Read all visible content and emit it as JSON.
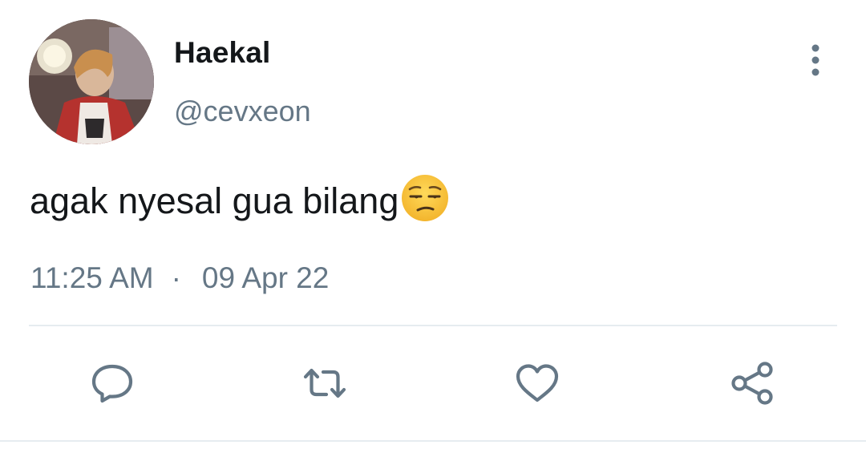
{
  "tweet": {
    "author": {
      "display_name": "Haekal",
      "handle": "@cevxeon"
    },
    "text": "agak nyesal gua bilang",
    "emoji": "unamused-face-emoji",
    "time": "11:25 AM",
    "separator": "·",
    "date": "09 Apr 22"
  },
  "actions": {
    "reply_icon": "speech-bubble-icon",
    "retweet_icon": "retweet-arrows-icon",
    "like_icon": "heart-icon",
    "share_icon": "share-nodes-icon",
    "more_icon": "vertical-ellipsis-icon"
  },
  "colors": {
    "text_primary": "#14171a",
    "text_secondary": "#657786",
    "icon": "#657786",
    "divider": "#e6ecf0",
    "emoji_face": "#f7c33c"
  }
}
